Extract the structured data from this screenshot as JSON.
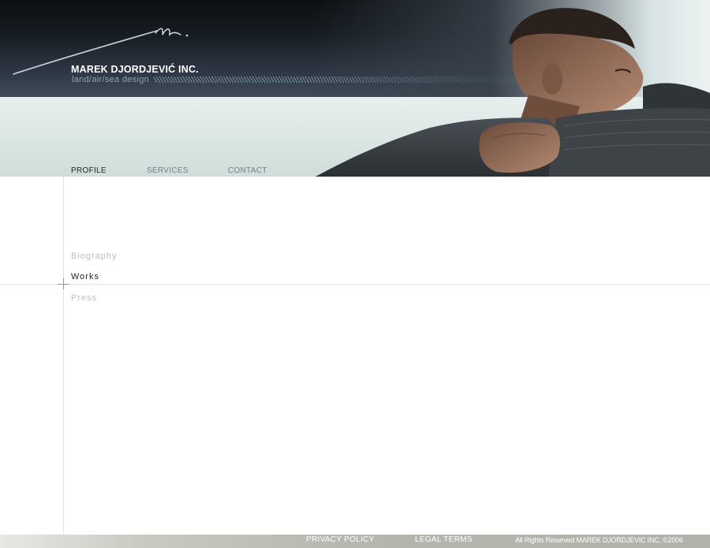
{
  "header": {
    "company_name": "MAREK DJORDJEVIĆ INC.",
    "tagline": "land/air/sea design"
  },
  "nav": {
    "items": [
      {
        "label": "PROFILE",
        "active": true
      },
      {
        "label": "SERVICES",
        "active": false
      },
      {
        "label": "CONTACT",
        "active": false
      }
    ]
  },
  "subnav": {
    "items": [
      {
        "label": "Biography",
        "active": false
      },
      {
        "label": "Works",
        "active": true
      },
      {
        "label": "Press",
        "active": false
      }
    ]
  },
  "footer": {
    "privacy": "PRIVACY POLICY",
    "legal": "LEGAL TERMS",
    "copyright": "All Rights Reserved MAREK DJORDJEVIC INC. ©2006"
  },
  "colors": {
    "header_dark": "#161c22",
    "header_light": "#dae6e3",
    "nav_active": "#1d2329",
    "nav_inactive": "#71808b",
    "subnav_inactive": "#b7c0c6",
    "footer": "#b4b7ad"
  },
  "icons": [
    "signature-logo",
    "portrait-photo"
  ]
}
